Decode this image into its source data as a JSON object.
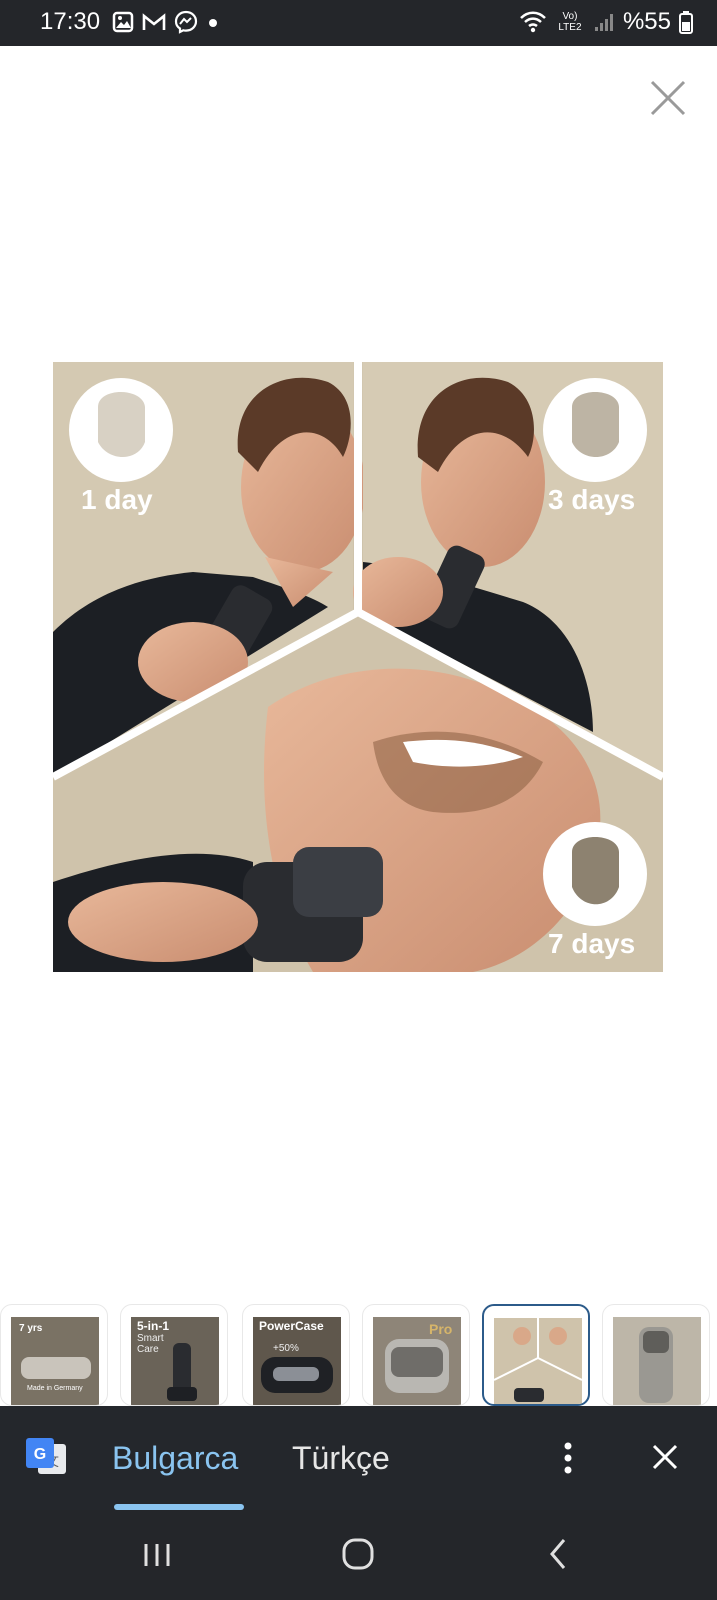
{
  "status_bar": {
    "time": "17:30",
    "battery_text": "%55",
    "network_label": "Vo) LTE2",
    "icons": [
      "gallery-icon",
      "gmail-icon",
      "messenger-icon",
      "dot-icon",
      "wifi-icon",
      "signal-icon",
      "battery-icon"
    ]
  },
  "viewer": {
    "close_icon": "close-icon"
  },
  "hero": {
    "labels": [
      "1 day",
      "3 days",
      "7 days"
    ]
  },
  "thumbnails": [
    {
      "badge": "7 yrs",
      "caption": "Made in Germany"
    },
    {
      "title": "5-in-1",
      "subtitle": "Smart Care"
    },
    {
      "title": "PowerCase",
      "subtitle": "+50%"
    },
    {
      "title": "Pro"
    },
    {
      "title": ""
    },
    {
      "title": ""
    }
  ],
  "translate_bar": {
    "icon": "google-translate-icon",
    "languages": [
      "Bulgarca",
      "Türkçe"
    ],
    "active_language": "Bulgarca",
    "more_icon": "more-vert-icon",
    "close_icon": "close-icon"
  },
  "nav_bar": {
    "icons": [
      "recents-icon",
      "home-icon",
      "back-icon"
    ]
  },
  "colors": {
    "status_bg": "#24262a",
    "translate_bg": "#24272c",
    "accent": "#8ac4f0",
    "thumb_active_border": "#2c5b8a"
  }
}
